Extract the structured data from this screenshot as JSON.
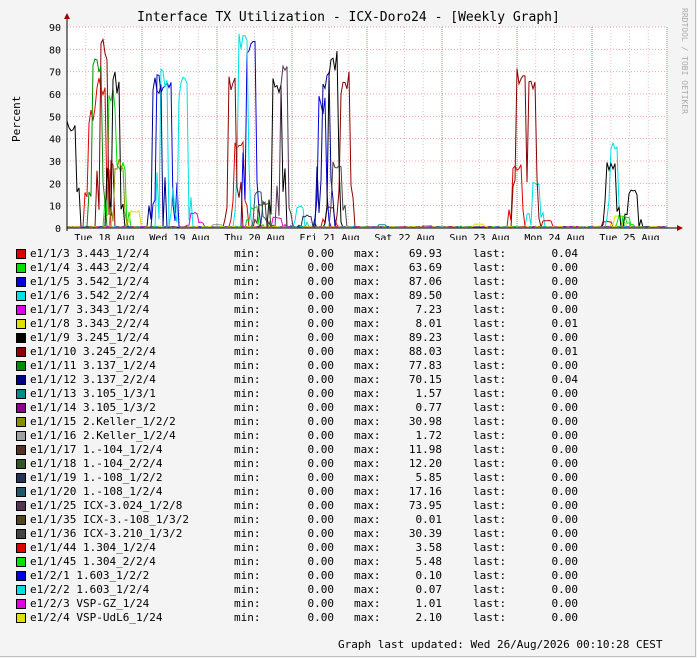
{
  "title": "Interface TX Utilization - ICX-Doro24 - [Weekly Graph]",
  "watermark": "RRDTOOL / TOBI OETIKER",
  "updated": "Graph last updated: Wed 26/Aug/2026 00:10:28 CEST",
  "chart_data": {
    "type": "line",
    "title": "Interface TX Utilization - ICX-Doro24 - [Weekly Graph]",
    "ylabel": "Percent",
    "ylim": [
      0,
      90
    ],
    "yticks": [
      "0",
      "10",
      "20",
      "30",
      "40",
      "50",
      "60",
      "70",
      "80",
      "90"
    ],
    "xticks": [
      "Tue 18 Aug",
      "Wed 19 Aug",
      "Thu 20 Aug",
      "Fri 21 Aug",
      "Sat 22 Aug",
      "Sun 23 Aug",
      "Mon 24 Aug",
      "Tue 25 Aug"
    ],
    "grid": true,
    "series": [
      {
        "name": "e1/1/3 3.443_1/2/4",
        "color": "#e00000",
        "min": "0.00",
        "max": "69.93",
        "last": "0.04",
        "peaks": [
          [
            0.35,
            55
          ],
          [
            0.45,
            70
          ],
          [
            2.3,
            40
          ],
          [
            3.5,
            10
          ],
          [
            6.0,
            30
          ],
          [
            7.2,
            3
          ]
        ]
      },
      {
        "name": "e1/1/4 3.443_2/2/4",
        "color": "#00e000",
        "min": "0.00",
        "max": "63.69",
        "last": "0.00",
        "peaks": [
          [
            0.6,
            63
          ],
          [
            0.72,
            30
          ],
          [
            2.5,
            10
          ],
          [
            7.4,
            6
          ]
        ]
      },
      {
        "name": "e1/1/5 3.542_1/2/4",
        "color": "#0000e0",
        "min": "0.00",
        "max": "87.06",
        "last": "0.00",
        "peaks": [
          [
            1.25,
            70
          ],
          [
            1.35,
            68
          ],
          [
            2.45,
            87
          ],
          [
            3.4,
            60
          ]
        ]
      },
      {
        "name": "e1/1/6 3.542_2/2/4",
        "color": "#00e0e0",
        "min": "0.00",
        "max": "89.50",
        "last": "0.00",
        "peaks": [
          [
            1.3,
            74
          ],
          [
            1.55,
            68
          ],
          [
            2.35,
            89.5
          ],
          [
            3.1,
            10
          ],
          [
            6.25,
            22
          ],
          [
            7.3,
            40
          ]
        ]
      },
      {
        "name": "e1/1/7 3.343_1/2/4",
        "color": "#e000e0",
        "min": "0.00",
        "max": "7.23",
        "last": "0.00",
        "peaks": [
          [
            1.7,
            7.2
          ],
          [
            2.8,
            5
          ]
        ]
      },
      {
        "name": "e1/1/8 3.343_2/2/4",
        "color": "#e0e000",
        "min": "0.00",
        "max": "8.01",
        "last": "0.01",
        "peaks": [
          [
            0.9,
            8
          ],
          [
            7.35,
            6
          ]
        ]
      },
      {
        "name": "e1/1/9 3.245_1/2/4",
        "color": "#000000",
        "min": "0.00",
        "max": "89.23",
        "last": "0.00",
        "peaks": [
          [
            0.05,
            50
          ],
          [
            0.65,
            70
          ],
          [
            2.8,
            70
          ],
          [
            3.55,
            80
          ],
          [
            7.25,
            30
          ],
          [
            7.55,
            17
          ]
        ]
      },
      {
        "name": "e1/1/10 3.245_2/2/4",
        "color": "#8b0000",
        "min": "0.00",
        "max": "88.03",
        "last": "0.01",
        "peaks": [
          [
            0.5,
            88
          ],
          [
            2.2,
            72
          ],
          [
            3.7,
            70
          ],
          [
            6.05,
            72
          ],
          [
            6.2,
            68
          ]
        ]
      },
      {
        "name": "e1/1/11 3.137_1/2/4",
        "color": "#008b00",
        "min": "0.00",
        "max": "77.83",
        "last": "0.00",
        "peaks": [
          [
            0.4,
            77.8
          ]
        ]
      },
      {
        "name": "e1/1/12 3.137_2/2/4",
        "color": "#00008b",
        "min": "0.00",
        "max": "70.15",
        "last": "0.04",
        "peaks": [
          [
            1.2,
            70
          ],
          [
            3.45,
            70
          ]
        ]
      },
      {
        "name": "e1/1/13 3.105_1/3/1",
        "color": "#008b8b",
        "min": "0.00",
        "max": "1.57",
        "last": "0.00",
        "peaks": [
          [
            4.2,
            1.5
          ]
        ]
      },
      {
        "name": "e1/1/14 3.105_1/3/2",
        "color": "#8b008b",
        "min": "0.00",
        "max": "0.77",
        "last": "0.00",
        "peaks": [
          [
            5.1,
            0.7
          ]
        ]
      },
      {
        "name": "e1/1/15 2.Keller_1/2/2",
        "color": "#8b8b00",
        "min": "0.00",
        "max": "30.98",
        "last": "0.00",
        "peaks": [
          [
            0.7,
            31
          ]
        ]
      },
      {
        "name": "e1/1/16 2.Keller_1/2/4",
        "color": "#a0a0a0",
        "min": "0.00",
        "max": "1.72",
        "last": "0.00",
        "peaks": [
          [
            2.0,
            1.7
          ]
        ]
      },
      {
        "name": "e1/1/17 1.-104_1/2/4",
        "color": "#553322",
        "min": "0.00",
        "max": "11.98",
        "last": "0.00",
        "peaks": [
          [
            2.6,
            12
          ]
        ]
      },
      {
        "name": "e1/1/18 1.-104_2/2/4",
        "color": "#335522",
        "min": "0.00",
        "max": "12.20",
        "last": "0.00",
        "peaks": [
          [
            2.65,
            12.2
          ]
        ]
      },
      {
        "name": "e1/1/19 1.-108_1/2/2",
        "color": "#223355",
        "min": "0.00",
        "max": "5.85",
        "last": "0.00",
        "peaks": [
          [
            3.2,
            5.8
          ]
        ]
      },
      {
        "name": "e1/1/20 1.-108_1/2/4",
        "color": "#225566",
        "min": "0.00",
        "max": "17.16",
        "last": "0.00",
        "peaks": [
          [
            2.55,
            17
          ]
        ]
      },
      {
        "name": "e1/1/25 ICX-3.024_1/2/8",
        "color": "#553355",
        "min": "0.00",
        "max": "73.95",
        "last": "0.00",
        "peaks": [
          [
            2.9,
            73.9
          ]
        ]
      },
      {
        "name": "e1/1/35 ICX-3.-108_1/3/2",
        "color": "#554422",
        "min": "0.00",
        "max": "0.01",
        "last": "0.00",
        "peaks": []
      },
      {
        "name": "e1/1/36 ICX-3.210_1/3/2",
        "color": "#444444",
        "min": "0.00",
        "max": "30.39",
        "last": "0.00",
        "peaks": [
          [
            3.6,
            30
          ]
        ]
      },
      {
        "name": "e1/1/44 1.304_1/2/4",
        "color": "#e00000",
        "min": "0.00",
        "max": "3.58",
        "last": "0.00",
        "peaks": [
          [
            6.4,
            3.5
          ]
        ]
      },
      {
        "name": "e1/1/45 1.304_2/2/4",
        "color": "#00e000",
        "min": "0.00",
        "max": "5.48",
        "last": "0.00",
        "peaks": [
          [
            7.45,
            5.4
          ]
        ]
      },
      {
        "name": "e1/2/1 1.603_1/2/2",
        "color": "#0000e0",
        "min": "0.00",
        "max": "0.10",
        "last": "0.00",
        "peaks": []
      },
      {
        "name": "e1/2/2 1.603_1/2/4",
        "color": "#00e0e0",
        "min": "0.00",
        "max": "0.07",
        "last": "0.00",
        "peaks": []
      },
      {
        "name": "e1/2/3 VSP-GZ_1/24",
        "color": "#e000e0",
        "min": "0.00",
        "max": "1.01",
        "last": "0.00",
        "peaks": [
          [
            4.8,
            1
          ]
        ]
      },
      {
        "name": "e1/2/4 VSP-UdL6_1/24",
        "color": "#e0e000",
        "min": "0.00",
        "max": "2.10",
        "last": "0.00",
        "peaks": [
          [
            5.5,
            2
          ]
        ]
      }
    ]
  },
  "legend_labels": {
    "min": "min:",
    "max": "max:",
    "last": "last:"
  }
}
